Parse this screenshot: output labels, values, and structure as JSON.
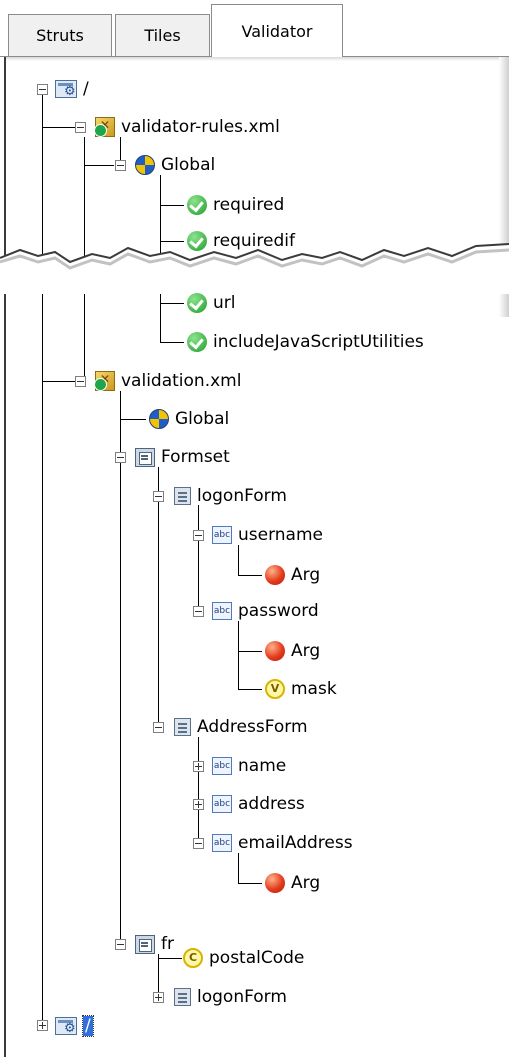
{
  "tabs": [
    {
      "label": "Struts",
      "active": false
    },
    {
      "label": "Tiles",
      "active": false
    },
    {
      "label": "Validator",
      "active": true
    }
  ],
  "tree": {
    "root": {
      "label": "/"
    },
    "validator_rules": {
      "label": "validator-rules.xml",
      "global": {
        "label": "Global",
        "items": [
          "required",
          "requiredif",
          "url",
          "includeJavaScriptUtilities"
        ]
      }
    },
    "validation": {
      "label": "validation.xml",
      "global": {
        "label": "Global"
      },
      "formset": {
        "label": "Formset",
        "logonForm": {
          "label": "logonForm",
          "username": {
            "label": "username",
            "arg": "Arg"
          },
          "password": {
            "label": "password",
            "arg": "Arg",
            "mask": "mask"
          }
        },
        "addressForm": {
          "label": "AddressForm",
          "name": "name",
          "address": "address",
          "emailAddress": {
            "label": "emailAddress",
            "arg": "Arg"
          }
        }
      },
      "fr": {
        "label": "fr",
        "postalCode": "postalCode",
        "logonForm": "logonForm"
      }
    },
    "root2": {
      "label": "/"
    }
  },
  "icons": {
    "var_letter": "V",
    "const_letter": "C",
    "abc_text": "abc"
  }
}
